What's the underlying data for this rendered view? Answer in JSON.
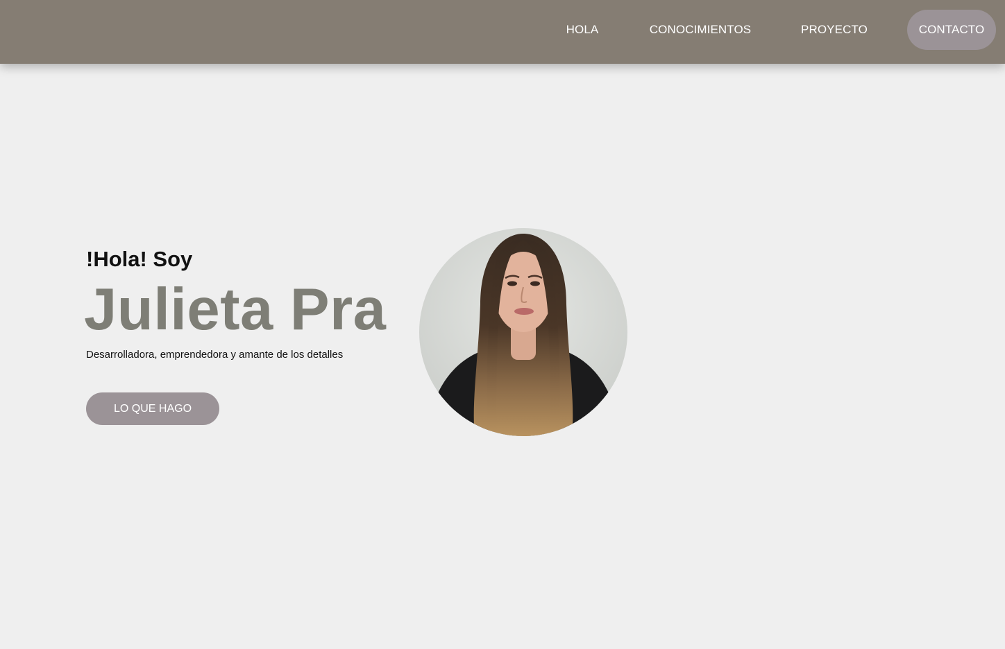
{
  "nav": {
    "items": [
      {
        "label": "HOLA"
      },
      {
        "label": "CONOCIMIENTOS"
      },
      {
        "label": "PROYECTO"
      },
      {
        "label": "CONTACTO",
        "active": true
      }
    ]
  },
  "hero": {
    "greeting": "!Hola! Soy",
    "name": "Julieta Pra",
    "tagline": "Desarrolladora, emprendedora y amante de los detalles",
    "cta_label": "LO QUE HAGO"
  },
  "colors": {
    "navbar": "#857d73",
    "page_bg": "#efefef",
    "accent": "#9b9397",
    "name_text": "#7e7e76"
  }
}
